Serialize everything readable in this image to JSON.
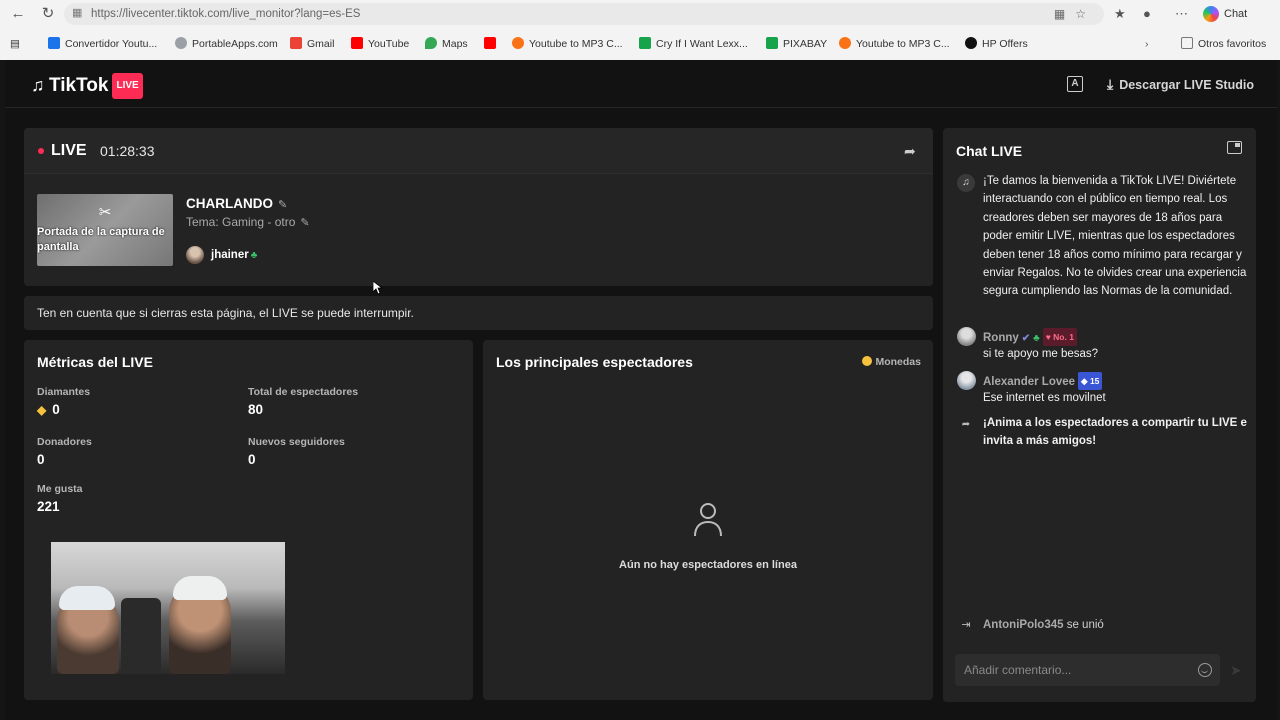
{
  "browser": {
    "url": "https://livecenter.tiktok.com/live_monitor?lang=es-ES",
    "chat_label": "Chat",
    "bookmarks": [
      {
        "label": "Convertidor Youtu...",
        "color": "#1a73e8"
      },
      {
        "label": "PortableApps.com",
        "color": "#9aa0a6"
      },
      {
        "label": "Gmail",
        "color": "#ea4335"
      },
      {
        "label": "YouTube",
        "color": "#ff0000"
      },
      {
        "label": "Maps",
        "color": "#34a853"
      },
      {
        "label": "",
        "color": "#ff0000"
      },
      {
        "label": "Youtube to MP3 C...",
        "color": "#f97316"
      },
      {
        "label": "Cry If I Want Lexx...",
        "color": "#16a34a"
      },
      {
        "label": "PIXABAY",
        "color": "#16a34a"
      },
      {
        "label": "Youtube to MP3 C...",
        "color": "#f97316"
      },
      {
        "label": "HP Offers",
        "color": "#111111"
      }
    ],
    "other_favorites": "Otros favoritos"
  },
  "header": {
    "brand": "TikTok",
    "live_badge": "LIVE",
    "download_label": "Descargar LIVE Studio"
  },
  "status": {
    "live_label": "LIVE",
    "timer": "01:28:33",
    "cover_text": "Portada de la captura de pantalla",
    "title": "CHARLANDO",
    "topic": "Tema: Gaming - otro",
    "host": "jhainer"
  },
  "notice": "Ten en cuenta que si cierras esta página, el LIVE se puede interrumpir.",
  "metrics": {
    "title": "Métricas del LIVE",
    "diamonds_label": "Diamantes",
    "diamonds_value": "0",
    "viewers_label": "Total de espectadores",
    "viewers_value": "80",
    "donors_label": "Donadores",
    "donors_value": "0",
    "followers_label": "Nuevos seguidores",
    "followers_value": "0",
    "likes_label": "Me gusta",
    "likes_value": "221"
  },
  "top_viewers": {
    "title": "Los principales espectadores",
    "coins_label": "Monedas",
    "empty_text": "Aún no hay espectadores en línea"
  },
  "chat": {
    "title": "Chat LIVE",
    "welcome": "¡Te damos la bienvenida a TikTok LIVE! Diviértete interactuando con el público en tiempo real. Los creadores deben ser mayores de 18 años para poder emitir LIVE, mientras que los espectadores deben tener 18 años como mínimo para recargar y enviar Regalos. No te olvides crear una experiencia segura cumpliendo las Normas de la comunidad.",
    "messages": [
      {
        "user": "Ronny",
        "badge": "No. 1",
        "text": "si te apoyo me besas?"
      },
      {
        "user": "Alexander Lovee",
        "badge": "15",
        "text": "Ese internet es movilnet"
      }
    ],
    "share_prompt": "¡Anima a los espectadores a compartir tu LIVE e invita a más amigos!",
    "joined_user": "AntoniPolo345",
    "joined_text": "se unió",
    "comment_placeholder": "Añadir comentario..."
  },
  "colors": {
    "accent": "#fe2c55",
    "background": "#121212",
    "panel": "#232323",
    "coin": "#f6c23e"
  }
}
